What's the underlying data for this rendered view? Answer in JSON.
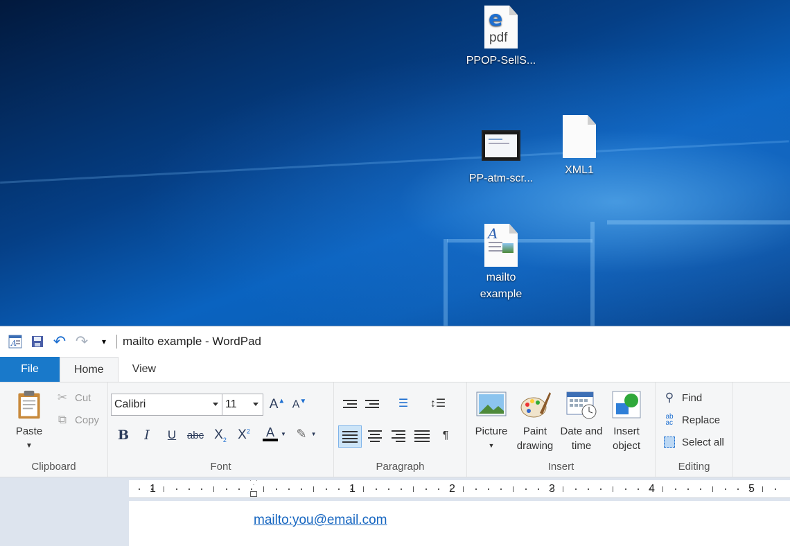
{
  "desktop": {
    "icons": [
      {
        "label": "PPOP-SellS...",
        "icon": "edge-pdf-icon"
      },
      {
        "label": "PP-atm-scr...",
        "icon": "screenshot-thumbnail-icon"
      },
      {
        "label": "XML1",
        "icon": "blank-file-icon"
      },
      {
        "label": "mailto\nexample",
        "label_line1": "mailto",
        "label_line2": "example",
        "icon": "wordpad-document-icon"
      }
    ]
  },
  "window": {
    "title": "mailto example - WordPad",
    "tabs": [
      "File",
      "Home",
      "View"
    ],
    "active_tab": "Home"
  },
  "ribbon": {
    "clipboard": {
      "label": "Clipboard",
      "paste": "Paste",
      "cut": "Cut",
      "copy": "Copy"
    },
    "font": {
      "label": "Font",
      "family": "Calibri",
      "size": "11"
    },
    "paragraph": {
      "label": "Paragraph"
    },
    "insert": {
      "label": "Insert",
      "picture": "Picture",
      "paint_line1": "Paint",
      "paint_line2": "drawing",
      "datetime_line1": "Date and",
      "datetime_line2": "time",
      "object_line1": "Insert",
      "object_line2": "object"
    },
    "editing": {
      "label": "Editing",
      "find": "Find",
      "replace": "Replace",
      "select_all": "Select all"
    }
  },
  "ruler": {
    "numbers": [
      "1",
      "1",
      "2",
      "3",
      "4",
      "5"
    ]
  },
  "document": {
    "text": "mailto:you@email.com"
  },
  "colors": {
    "accent": "#1979ca",
    "link": "#1565c0",
    "ribbon_bg": "#f5f6f7"
  }
}
